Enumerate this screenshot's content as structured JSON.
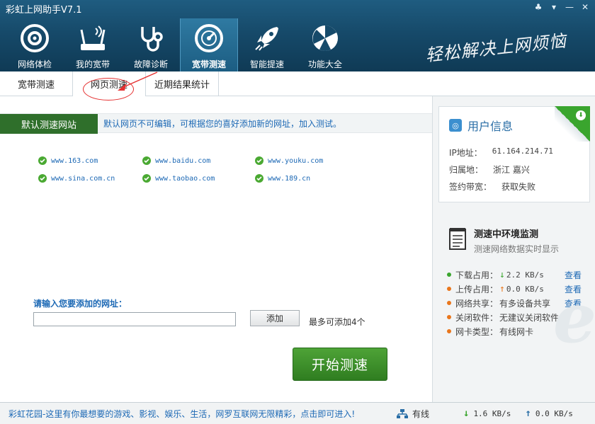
{
  "app": {
    "title": "彩虹上网助手V7.1"
  },
  "window_controls": [
    {
      "name": "skin-icon",
      "glyph": "♣"
    },
    {
      "name": "menu-icon",
      "glyph": "▾"
    },
    {
      "name": "minimize-icon",
      "glyph": "—"
    },
    {
      "name": "close-icon",
      "glyph": "✕"
    }
  ],
  "nav": {
    "items": [
      {
        "label": "网络体检",
        "icon": "target-icon"
      },
      {
        "label": "我的宽带",
        "icon": "router-icon"
      },
      {
        "label": "故障诊断",
        "icon": "stethoscope-icon"
      },
      {
        "label": "宽带测速",
        "icon": "speedometer-icon",
        "active": true
      },
      {
        "label": "智能提速",
        "icon": "rocket-icon"
      },
      {
        "label": "功能大全",
        "icon": "apps-icon"
      }
    ],
    "slogan": "轻松解决上网烦恼"
  },
  "subtabs": [
    {
      "label": "宽带测速"
    },
    {
      "label": "网页测速",
      "active": true
    },
    {
      "label": "近期结果统计"
    }
  ],
  "section": {
    "tag": "默认测速网站",
    "desc": "默认网页不可编辑，可根据您的喜好添加新的网址，加入测试。"
  },
  "sites": [
    "www.163.com",
    "www.baidu.com",
    "www.youku.com",
    "www.sina.com.cn",
    "www.taobao.com",
    "www.189.cn"
  ],
  "url_form": {
    "label": "请输入您要添加的网址：",
    "value": "",
    "add_label": "添加",
    "hint": "最多可添加4个"
  },
  "start_button": "开始测速",
  "user_info": {
    "title": "用户信息",
    "rows": [
      {
        "key": "IP地址：",
        "value": "61.164.214.71"
      },
      {
        "key": "归属地：",
        "value": "浙江 嘉兴"
      },
      {
        "key": "签约带宽：",
        "value": "获取失败"
      }
    ]
  },
  "env": {
    "title": "测速中环境监测",
    "subtitle": "测速网络数据实时显示",
    "rows": [
      {
        "key": "下载占用：",
        "value": "2.2 KB/s",
        "arrow": "down",
        "link": "查看",
        "bullet": "#3aa52e"
      },
      {
        "key": "上传占用：",
        "value": "0.0 KB/s",
        "arrow": "up",
        "link": "查看",
        "bullet": "#e9761c"
      },
      {
        "key": "网络共享：",
        "value": "有多设备共享",
        "link": "查看",
        "bullet": "#e9761c"
      },
      {
        "key": "关闭软件：",
        "value": "无建议关闭软件",
        "bullet": "#e9761c"
      },
      {
        "key": "网卡类型：",
        "value": "有线网卡",
        "bullet": "#e9761c"
      }
    ]
  },
  "status": {
    "message": "彩虹花园-这里有你最想要的游戏、影视、娱乐、生活，网罗互联网无限精彩，点击即可进入!",
    "network": "有线",
    "download": "1.6 KB/s",
    "upload": "0.0 KB/s"
  },
  "colors": {
    "accent": "#1d69b5",
    "nav_bg": "#164a6a",
    "section_tag": "#2f6f2b",
    "start_button": "#3a8f28",
    "download_arrow": "#3aa52e",
    "upload_arrow": "#e9761c"
  }
}
